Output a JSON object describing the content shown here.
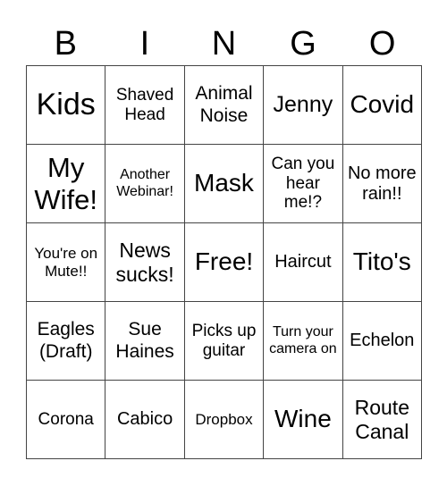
{
  "header": {
    "letters": [
      "B",
      "I",
      "N",
      "G",
      "O"
    ]
  },
  "cells": [
    "Kids",
    "Shaved Head",
    "Animal Noise",
    "Jenny",
    "Covid",
    "My Wife!",
    "Another Webinar!",
    "Mask",
    "Can you hear me!?",
    "No more rain!!",
    "You're on Mute!!",
    "News sucks!",
    "Free!",
    "Haircut",
    "Tito's",
    "Eagles (Draft)",
    "Sue Haines",
    "Picks up guitar",
    "Turn your camera on",
    "Echelon",
    "Corona",
    "Cabico",
    "Dropbox",
    "Wine",
    "Route Canal"
  ]
}
